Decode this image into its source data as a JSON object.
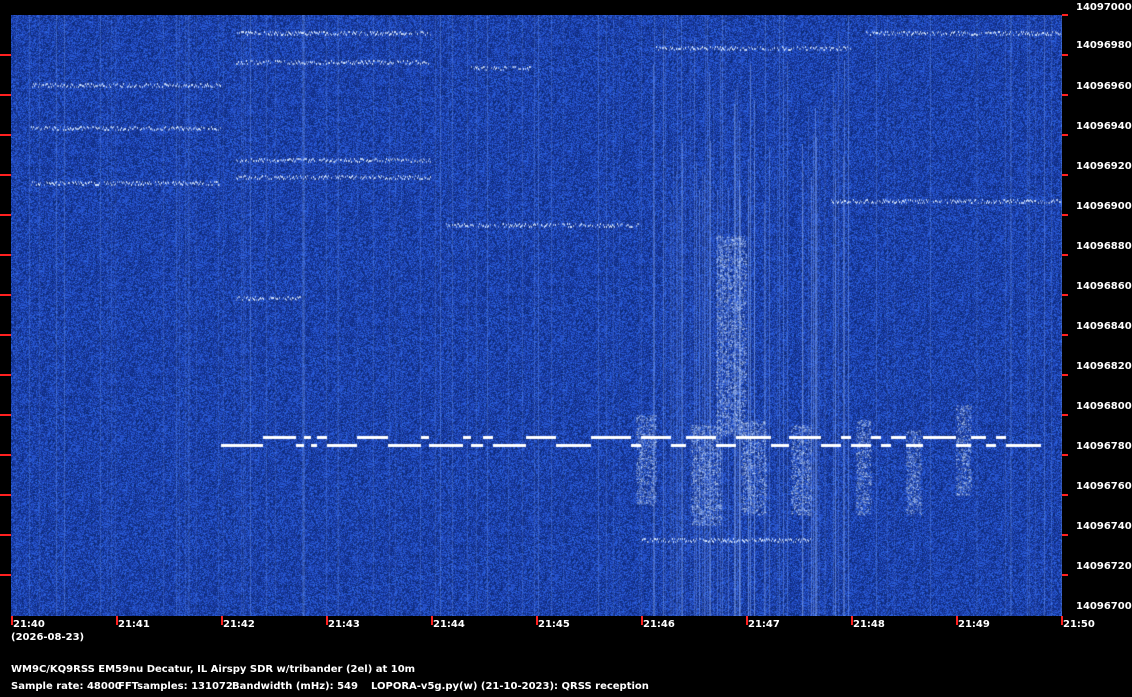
{
  "y_axis": {
    "labels": [
      "14097000",
      "14096980",
      "14096960",
      "14096940",
      "14096920",
      "14096900",
      "14096880",
      "14096860",
      "14096840",
      "14096820",
      "14096800",
      "14096780",
      "14096760",
      "14096740",
      "14096720",
      "14096700"
    ]
  },
  "x_axis": {
    "labels": [
      "21:40",
      "21:41",
      "21:42",
      "21:43",
      "21:44",
      "21:45",
      "21:46",
      "21:47",
      "21:48",
      "21:49",
      "21:50"
    ],
    "date": "(2026-08-23)"
  },
  "info": {
    "station": "WM9C/KQ9RSS EM59nu Decatur, IL  Airspy SDR w/tribander (2el) at 10m",
    "sample_rate": "Sample rate: 48000",
    "fft_samples": "FFTsamples: 131072",
    "bandwidth": "Bandwidth (mHz): 549",
    "software": "LOPORA-v5g.py(w) (21-10-2023): QRSS reception"
  },
  "colors": {
    "background": "#0b2a6e",
    "signal": "#ffffff",
    "tick": "#ff2020"
  }
}
